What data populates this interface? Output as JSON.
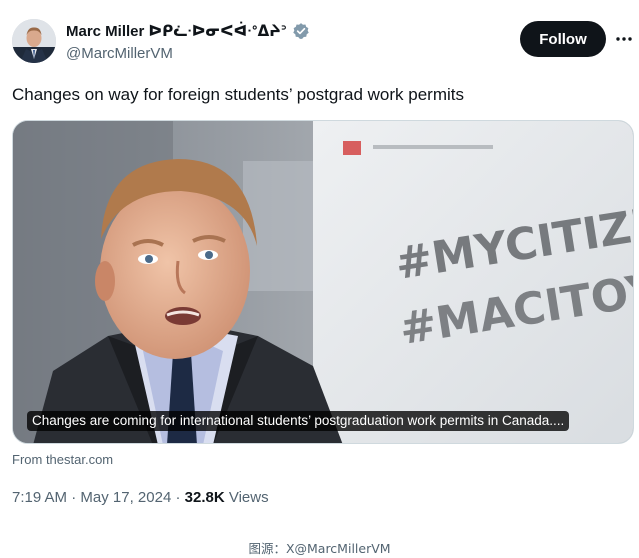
{
  "author": {
    "name": "Marc Miller ᐅᑭᓛᐧᐅᓂᐸᐋᐧᐤᐃᔨᐣ",
    "handle": "@MarcMillerVM",
    "verified": true
  },
  "actions": {
    "follow_label": "Follow",
    "more_icon": "more-horizontal-icon"
  },
  "tweet": {
    "text": "Changes on way for foreign students’ postgrad work permits"
  },
  "media": {
    "caption": "Changes are coming for international students’ postgraduation work permits in Canada....",
    "backdrop_line1": "#MYCITIZENSHIP",
    "backdrop_line2": "#MACITOYENNETÉ",
    "source": "From thestar.com"
  },
  "meta": {
    "time": "7:19 AM",
    "date": "May 17, 2024",
    "views_count": "32.8K",
    "views_label": "Views"
  },
  "credit": "图源：X@MarcMillerVM",
  "colors": {
    "text_primary": "#0f1419",
    "text_secondary": "#536471",
    "verified_badge": "#829aab",
    "button_bg": "#0f1419"
  }
}
